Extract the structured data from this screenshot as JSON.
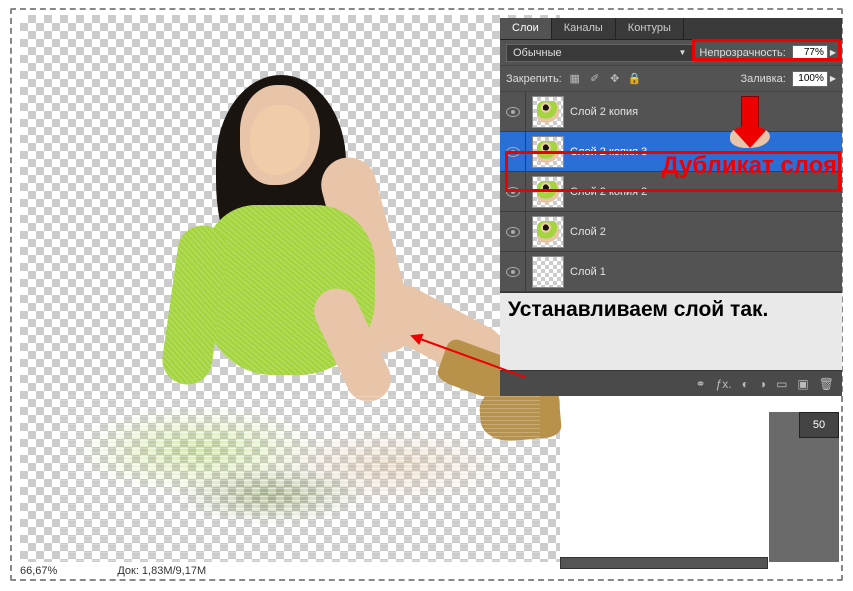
{
  "status": {
    "zoom": "66,67%",
    "doc": "Док: 1,83M/9,17M"
  },
  "panel": {
    "tabs": {
      "layers": "Слои",
      "channels": "Каналы",
      "paths": "Контуры"
    },
    "blend_mode": "Обычные",
    "opacity_label": "Непрозрачность:",
    "opacity_value": "77%",
    "lock_label": "Закрепить:",
    "fill_label": "Заливка:",
    "fill_value": "100%",
    "layers": [
      {
        "name": "Слой 2 копия"
      },
      {
        "name": "Слой 2 копия 3"
      },
      {
        "name": "Слой 2 копия 2"
      },
      {
        "name": "Слой 2"
      },
      {
        "name": "Слой 1"
      }
    ]
  },
  "annotations": {
    "duplicate": "Дубликат слоя",
    "instruction": "Устанавливаем слой так."
  },
  "side_value": "50"
}
